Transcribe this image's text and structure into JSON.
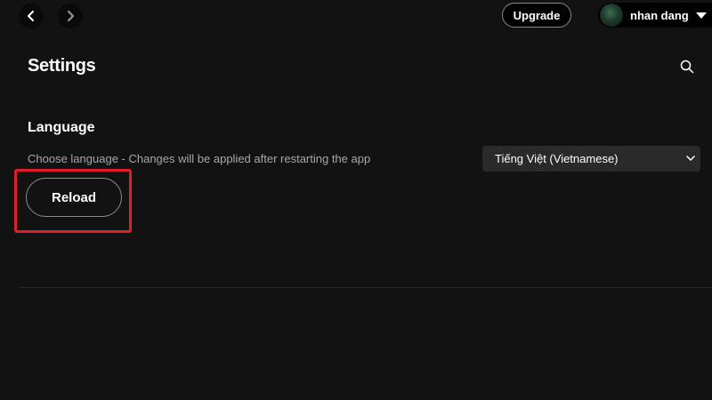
{
  "topbar": {
    "back_icon": "chevron-left-icon",
    "forward_icon": "chevron-right-icon",
    "upgrade_label": "Upgrade",
    "user_name": "nhan dang",
    "user_menu_icon": "caret-down-icon"
  },
  "settings": {
    "title": "Settings",
    "search_icon": "search-icon",
    "language": {
      "heading": "Language",
      "description": "Choose language - Changes will be applied after restarting the app",
      "selected": "Tiếng Việt (Vietnamese)"
    },
    "reload_label": "Reload"
  },
  "colors": {
    "background": "#121212",
    "highlight": "#e11d2a",
    "secondary_text": "#a7a7a7",
    "select_bg": "#2a2a2a"
  }
}
